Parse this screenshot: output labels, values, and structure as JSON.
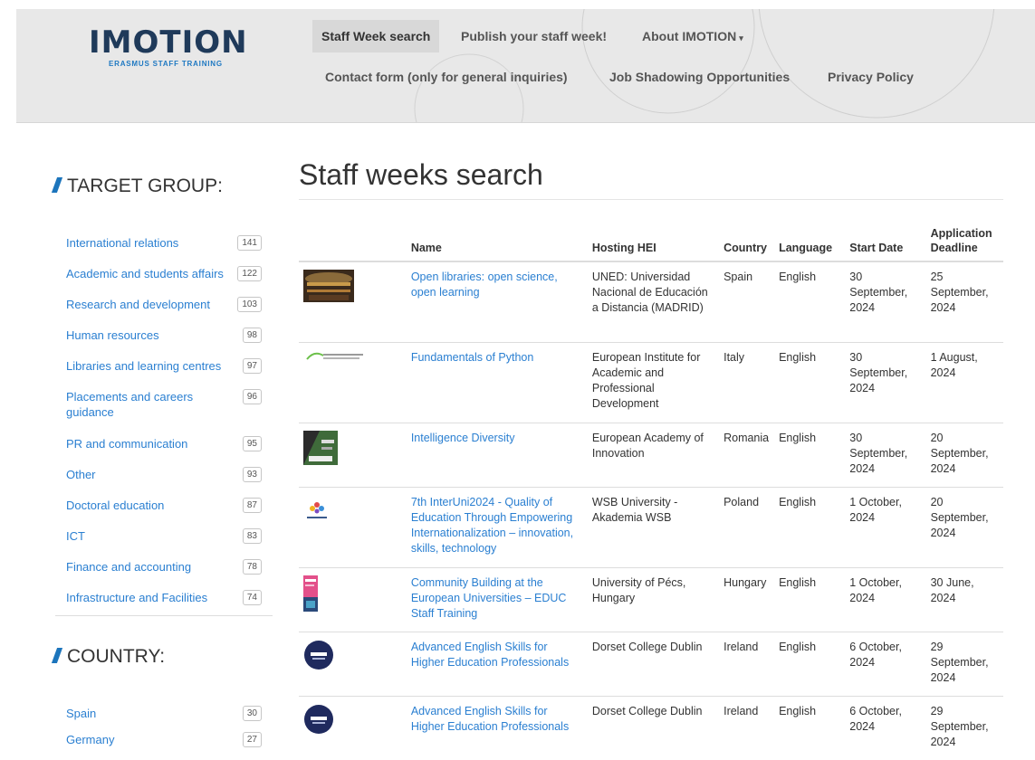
{
  "header": {
    "logo_text": "IMOTION",
    "logo_subtitle": "ERASMUS STAFF TRAINING",
    "nav": [
      {
        "label": "Staff Week search"
      },
      {
        "label": "Publish your staff week!"
      },
      {
        "label": "About IMOTION"
      },
      {
        "label": "Contact form (only for general inquiries)"
      },
      {
        "label": "Job Shadowing Opportunities"
      },
      {
        "label": "Privacy Policy"
      }
    ]
  },
  "sidebar": {
    "target_group": {
      "title": "TARGET GROUP:",
      "items": [
        {
          "label": "International relations",
          "count": "141"
        },
        {
          "label": "Academic and students affairs",
          "count": "122"
        },
        {
          "label": "Research and development",
          "count": "103"
        },
        {
          "label": "Human resources",
          "count": "98"
        },
        {
          "label": "Libraries and learning centres",
          "count": "97"
        },
        {
          "label": "Placements and careers guidance",
          "count": "96"
        },
        {
          "label": "PR and communication",
          "count": "95"
        },
        {
          "label": "Other",
          "count": "93"
        },
        {
          "label": "Doctoral education",
          "count": "87"
        },
        {
          "label": "ICT",
          "count": "83"
        },
        {
          "label": "Finance and accounting",
          "count": "78"
        },
        {
          "label": "Infrastructure and Facilities",
          "count": "74"
        }
      ]
    },
    "country": {
      "title": "COUNTRY:",
      "items": [
        {
          "label": "Spain",
          "count": "30"
        },
        {
          "label": "Germany",
          "count": "27"
        }
      ]
    }
  },
  "main": {
    "title": "Staff weeks search",
    "columns": {
      "name": "Name",
      "hei": "Hosting HEI",
      "country": "Country",
      "language": "Language",
      "start": "Start Date",
      "deadline": "Application Deadline"
    },
    "rows": [
      {
        "name": "Open libraries: open science, open learning",
        "hei": "UNED: Universidad Nacional de Educación a Distancia (MADRID)",
        "country": "Spain",
        "language": "English",
        "start": "30 September, 2024",
        "deadline": "25 September, 2024",
        "thumb": "library-photo-thumbnail"
      },
      {
        "name": "Fundamentals of Python",
        "hei": "European Institute for Academic and Professional Development",
        "country": "Italy",
        "language": "English",
        "start": "30 September, 2024",
        "deadline": "1 August, 2024",
        "thumb": "institute-logo-thumbnail"
      },
      {
        "name": "Intelligence Diversity",
        "hei": "European Academy of Innovation",
        "country": "Romania",
        "language": "English",
        "start": "30 September, 2024",
        "deadline": "20 September, 2024",
        "thumb": "flyer-thumbnail"
      },
      {
        "name": "7th InterUni2024 - Quality of Education Through Empowering Internationalization – innovation, skills, technology",
        "hei": "WSB University - Akademia WSB",
        "country": "Poland",
        "language": "English",
        "start": "1 October, 2024",
        "deadline": "20 September, 2024",
        "thumb": "interuni-logo-thumbnail"
      },
      {
        "name": "Community Building at the European Universities – EDUC Staff Training",
        "hei": "University of Pécs, Hungary",
        "country": "Hungary",
        "language": "English",
        "start": "1 October, 2024",
        "deadline": "30 June, 2024",
        "thumb": "educ-poster-thumbnail"
      },
      {
        "name": "Advanced English Skills for Higher Education Professionals",
        "hei": "Dorset College Dublin",
        "country": "Ireland",
        "language": "English",
        "start": "6 October, 2024",
        "deadline": "29 September, 2024",
        "thumb": "dorset-logo-thumbnail"
      },
      {
        "name": "Advanced English Skills for Higher Education Professionals",
        "hei": "Dorset College Dublin",
        "country": "Ireland",
        "language": "English",
        "start": "6 October, 2024",
        "deadline": "29 September, 2024",
        "thumb": "dorset-logo-thumbnail"
      }
    ]
  },
  "colors": {
    "link": "#2a7fd1",
    "brand_navy": "#1f3a5a",
    "accent_blue": "#1c75bc"
  }
}
